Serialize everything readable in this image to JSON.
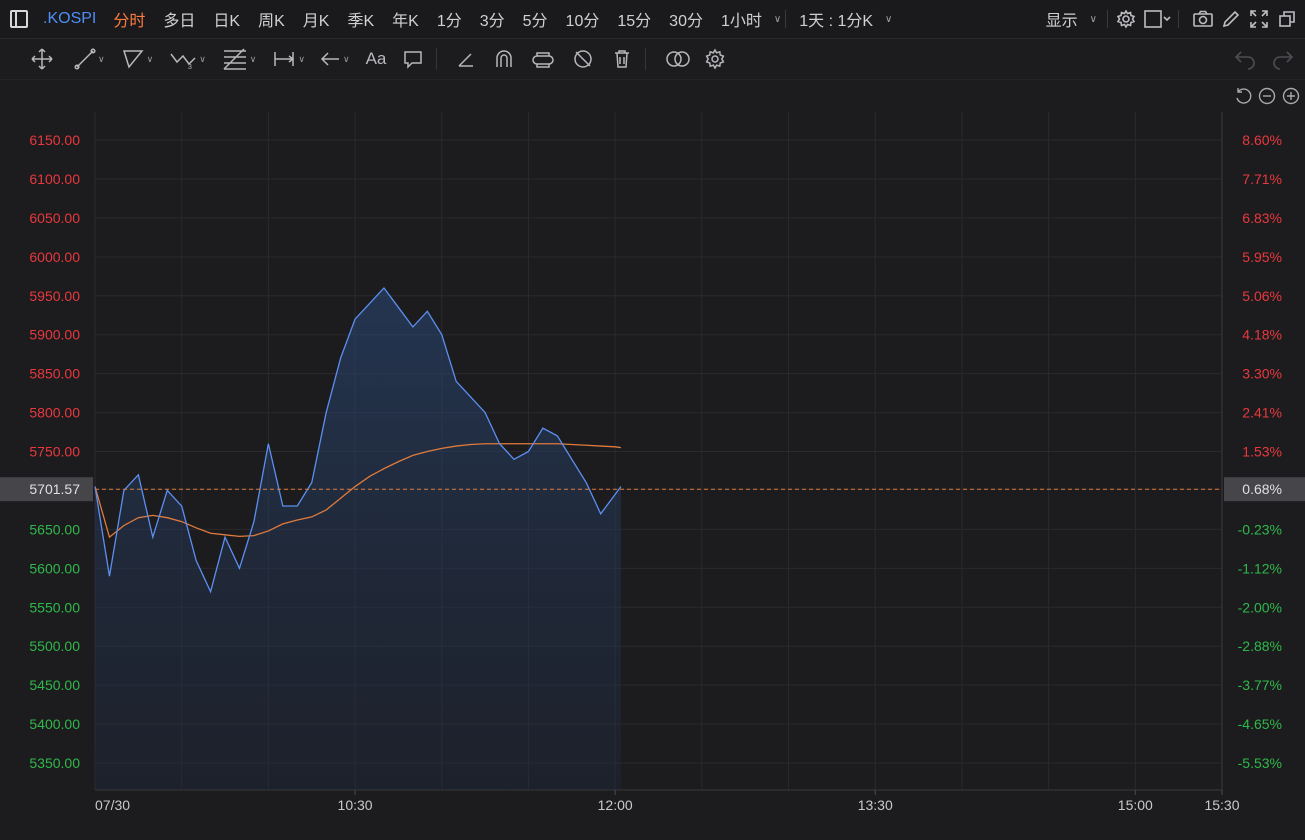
{
  "header": {
    "symbol": ".KOSPI",
    "periods": [
      "分时",
      "多日",
      "日K",
      "周K",
      "月K",
      "季K",
      "年K",
      "1分",
      "3分",
      "5分",
      "10分",
      "15分",
      "30分",
      "1小时"
    ],
    "active_period": "分时",
    "interval_select": "1天 : 1分K",
    "display_label": "显示"
  },
  "drawing_tools": {
    "text_tool_label": "Aa"
  },
  "colors": {
    "background": "#1c1c1f",
    "grid": "#2a2a2e",
    "price_line": "#5b8ff0",
    "avg_line": "#e07b3c",
    "up": "#e8383d",
    "down": "#2fb84a",
    "last_price_bg": "#45454a",
    "accent": "#ff7a3d",
    "symbol": "#4d8ef7"
  },
  "chart_data": {
    "type": "line",
    "date_label": "07/30",
    "x_ticks": [
      "10:30",
      "12:00",
      "13:30",
      "15:00",
      "15:30"
    ],
    "y_ticks_price": [
      "6150.00",
      "6100.00",
      "6050.00",
      "6000.00",
      "5950.00",
      "5900.00",
      "5850.00",
      "5800.00",
      "5750.00",
      "5701.57",
      "5650.00",
      "5600.00",
      "5550.00",
      "5500.00",
      "5450.00",
      "5400.00",
      "5350.00"
    ],
    "y_ticks_pct": [
      "8.60%",
      "7.71%",
      "6.83%",
      "5.95%",
      "5.06%",
      "4.18%",
      "3.30%",
      "2.41%",
      "1.53%",
      "0.68%",
      "-0.23%",
      "-1.12%",
      "-2.00%",
      "-2.88%",
      "-3.77%",
      "-4.65%",
      "-5.53%"
    ],
    "last_price": "5701.57",
    "last_pct": "0.68%",
    "ylim": [
      5330,
      6170
    ],
    "series": [
      {
        "x": [
          "09:00",
          "09:05",
          "09:10",
          "09:15",
          "09:20",
          "09:25",
          "09:30",
          "09:35",
          "09:40",
          "09:45",
          "09:50",
          "09:55",
          "10:00",
          "10:05",
          "10:10",
          "10:15",
          "10:20",
          "10:25",
          "10:30",
          "10:35",
          "10:40",
          "10:45",
          "10:50",
          "10:55",
          "11:00",
          "11:05",
          "11:10",
          "11:15",
          "11:20",
          "11:25",
          "11:30",
          "11:35",
          "11:40",
          "11:45",
          "11:50",
          "11:55",
          "12:00",
          "12:02"
        ],
        "values": [
          5705,
          5590,
          5700,
          5720,
          5640,
          5700,
          5680,
          5610,
          5570,
          5640,
          5600,
          5660,
          5760,
          5680,
          5680,
          5710,
          5800,
          5870,
          5920,
          5940,
          5960,
          5935,
          5910,
          5930,
          5900,
          5840,
          5820,
          5800,
          5760,
          5740,
          5750,
          5780,
          5770,
          5740,
          5710,
          5670,
          5695,
          5705
        ]
      },
      {
        "x": [
          "09:00",
          "09:05",
          "09:10",
          "09:15",
          "09:20",
          "09:25",
          "09:30",
          "09:35",
          "09:40",
          "09:45",
          "09:50",
          "09:55",
          "10:00",
          "10:05",
          "10:10",
          "10:15",
          "10:20",
          "10:25",
          "10:30",
          "10:35",
          "10:40",
          "10:45",
          "10:50",
          "10:55",
          "11:00",
          "11:05",
          "11:10",
          "11:15",
          "11:20",
          "11:25",
          "11:30",
          "11:35",
          "11:40",
          "11:45",
          "11:50",
          "11:55",
          "12:00",
          "12:02"
        ],
        "values": [
          5705,
          5640,
          5655,
          5665,
          5668,
          5665,
          5660,
          5652,
          5645,
          5643,
          5641,
          5642,
          5648,
          5657,
          5662,
          5666,
          5675,
          5690,
          5705,
          5718,
          5728,
          5737,
          5745,
          5750,
          5754,
          5757,
          5759,
          5760,
          5760,
          5760,
          5760,
          5760,
          5760,
          5759,
          5758,
          5757,
          5756,
          5755
        ]
      }
    ]
  }
}
